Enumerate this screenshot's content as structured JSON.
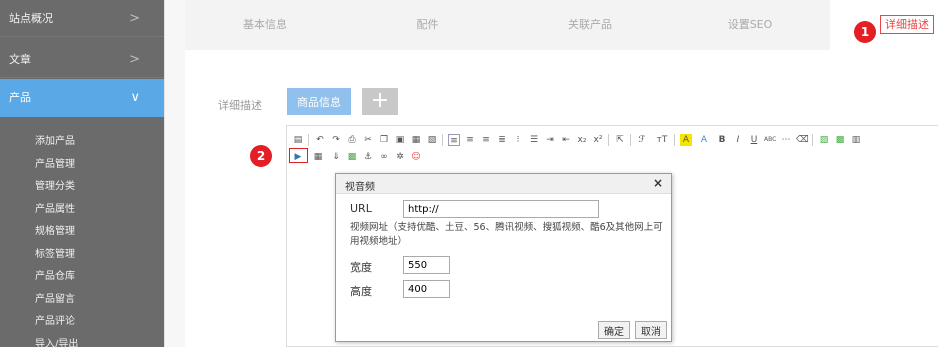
{
  "sidebar": {
    "items": [
      {
        "label": "站点概况",
        "chevron": ">"
      },
      {
        "label": "文章",
        "chevron": ">"
      },
      {
        "label": "产品",
        "chevron": "∨"
      }
    ],
    "sub_items": [
      "添加产品",
      "产品管理",
      "管理分类",
      "产品属性",
      "规格管理",
      "标签管理",
      "产品仓库",
      "产品留言",
      "产品评论",
      "导入/导出"
    ]
  },
  "tabs": [
    "基本信息",
    "配件",
    "关联产品",
    "设置SEO",
    "详细描述"
  ],
  "active_tab_index": 4,
  "markers": [
    "1",
    "2"
  ],
  "detail": {
    "label": "详细描述",
    "info_button": "商品信息",
    "add_button": "+"
  },
  "toolbar_icons": [
    "source-icon",
    "undo-icon",
    "redo-icon",
    "print-icon",
    "cut-icon",
    "copy-icon",
    "paste-icon",
    "paste-text-icon",
    "paste-word-icon",
    "align-left-icon",
    "align-center-icon",
    "align-right-icon",
    "justify-icon",
    "ordered-list-icon",
    "unordered-list-icon",
    "indent-icon",
    "outdent-icon",
    "subscript-icon",
    "superscript-icon",
    "select-all-icon",
    "font-family-icon",
    "font-size-icon",
    "font-color-icon",
    "bg-color-icon",
    "bold-icon",
    "italic-icon",
    "underline-icon",
    "strikethrough-icon",
    "horizontal-rule-icon",
    "clear-format-icon",
    "image-icon",
    "multi-image-icon",
    "video-icon",
    "table-icon",
    "insert-icon",
    "flash-icon",
    "anchor-icon",
    "link-icon",
    "unlink-icon",
    "emoticon-icon"
  ],
  "dialog": {
    "title": "视音频",
    "close": "×",
    "url_label": "URL",
    "url_value": "http://",
    "note": "视频网址（支持优酷、土豆、56、腾讯视频、搜狐视频、酷6及其他网上可用视频地址）",
    "width_label": "宽度",
    "width_value": "550",
    "height_label": "高度",
    "height_value": "400",
    "ok": "确定",
    "cancel": "取消"
  },
  "colors": {
    "sidebar": "#6b6b6b",
    "active": "#5aa9e6",
    "marker": "#e31e24",
    "info_button": "#8fc0ee"
  }
}
